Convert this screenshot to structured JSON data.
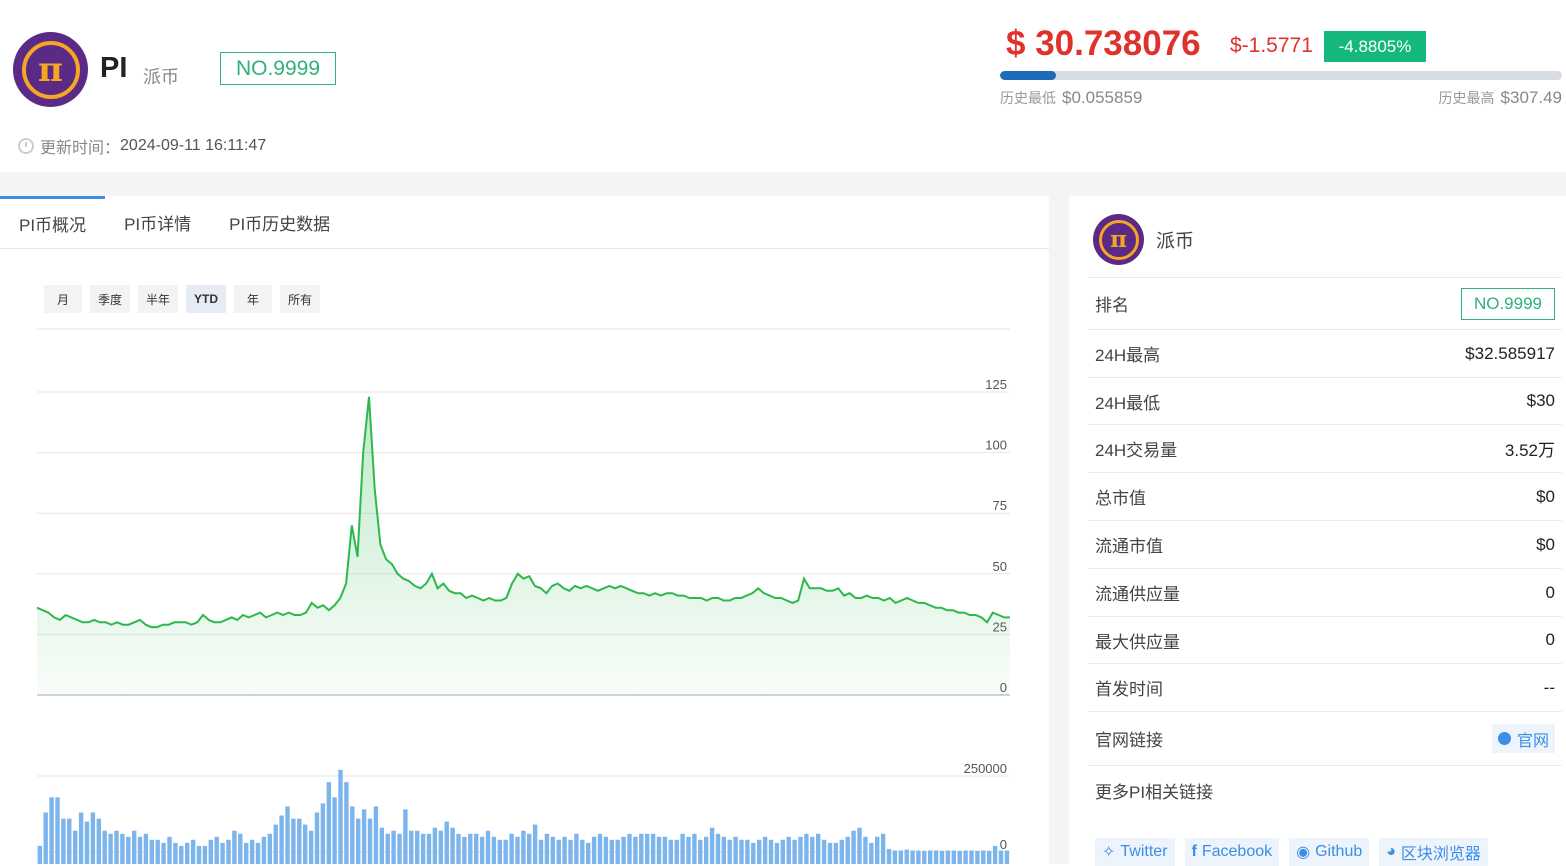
{
  "coin": {
    "symbol": "PI",
    "name": "派币",
    "rank": "NO.9999",
    "logo_icon": "pi-logo-icon"
  },
  "update": {
    "label": "更新时间：",
    "value": "2024-09-11 16:11:47"
  },
  "price": {
    "value": "$ 30.738076",
    "change": "$-1.5771",
    "change_pct": "-4.8805%",
    "range_position": 0.1
  },
  "range": {
    "low_label": "历史最低",
    "low_value": "$0.055859",
    "high_label": "历史最高",
    "high_value": "$307.49"
  },
  "tabs": [
    {
      "label": "PI币概况"
    },
    {
      "label": "PI币详情"
    },
    {
      "label": "PI币历史数据"
    }
  ],
  "range_buttons": [
    {
      "label": "月"
    },
    {
      "label": "季度"
    },
    {
      "label": "半年"
    },
    {
      "label": "YTD"
    },
    {
      "label": "年"
    },
    {
      "label": "所有"
    }
  ],
  "colors": {
    "price_down": "#e0322d",
    "badge_green": "#14b87b",
    "line": "#2db84d",
    "volume": "#7cb5ec"
  },
  "chart_data": {
    "type": "area",
    "price_axis": {
      "ticks": [
        "0",
        "25",
        "50",
        "75",
        "100",
        "125"
      ],
      "ylim": [
        0,
        125
      ]
    },
    "volume_axis": {
      "ticks": [
        "0",
        "250000"
      ],
      "ylim": [
        0,
        250000
      ]
    },
    "price_series": [
      36,
      35,
      34,
      32,
      31,
      33,
      32,
      31,
      30,
      30,
      31,
      30,
      30,
      29,
      30,
      29,
      29,
      30,
      31,
      29,
      28,
      28,
      29,
      29,
      30,
      30,
      30,
      29,
      30,
      33,
      31,
      30,
      30,
      31,
      32,
      31,
      33,
      32,
      33,
      34,
      32,
      33,
      34,
      33,
      34,
      33,
      33,
      34,
      38,
      36,
      37,
      35,
      37,
      40,
      46,
      70,
      57,
      100,
      123,
      85,
      62,
      56,
      54,
      50,
      48,
      47,
      45,
      44,
      46,
      50,
      44,
      46,
      43,
      42,
      42,
      40,
      41,
      40,
      39,
      40,
      39,
      39,
      40,
      46,
      50,
      48,
      49,
      45,
      44,
      42,
      45,
      46,
      44,
      43,
      45,
      44,
      45,
      44,
      43,
      44,
      45,
      44,
      45,
      44,
      43,
      42,
      42,
      41,
      42,
      41,
      42,
      42,
      41,
      41,
      40,
      40,
      40,
      39,
      40,
      40,
      39,
      39,
      40,
      40,
      41,
      42,
      44,
      42,
      41,
      40,
      40,
      39,
      38,
      39,
      48,
      44,
      44,
      44,
      43,
      43,
      44,
      41,
      42,
      40,
      40,
      41,
      40,
      40,
      39,
      40,
      38,
      39,
      40,
      39,
      38,
      38,
      37,
      36,
      36,
      35,
      35,
      34,
      34,
      33,
      33,
      32,
      30,
      34,
      33,
      32,
      32
    ],
    "volume_series": [
      20000,
      130000,
      180000,
      180000,
      110000,
      110000,
      70000,
      130000,
      100000,
      130000,
      110000,
      70000,
      60000,
      70000,
      60000,
      50000,
      70000,
      50000,
      60000,
      40000,
      40000,
      30000,
      50000,
      30000,
      20000,
      30000,
      40000,
      20000,
      20000,
      40000,
      50000,
      30000,
      40000,
      70000,
      60000,
      30000,
      40000,
      30000,
      50000,
      60000,
      90000,
      120000,
      150000,
      110000,
      110000,
      90000,
      70000,
      130000,
      160000,
      230000,
      180000,
      270000,
      230000,
      150000,
      110000,
      140000,
      110000,
      150000,
      80000,
      60000,
      70000,
      60000,
      140000,
      70000,
      70000,
      60000,
      60000,
      80000,
      70000,
      100000,
      80000,
      60000,
      50000,
      60000,
      60000,
      50000,
      70000,
      50000,
      40000,
      40000,
      60000,
      50000,
      70000,
      60000,
      90000,
      40000,
      60000,
      50000,
      40000,
      50000,
      40000,
      60000,
      40000,
      30000,
      50000,
      60000,
      50000,
      40000,
      40000,
      50000,
      60000,
      50000,
      60000,
      60000,
      60000,
      50000,
      50000,
      40000,
      40000,
      60000,
      50000,
      60000,
      40000,
      50000,
      80000,
      60000,
      50000,
      40000,
      50000,
      40000,
      40000,
      30000,
      40000,
      50000,
      40000,
      30000,
      40000,
      50000,
      40000,
      50000,
      60000,
      50000,
      60000,
      40000,
      30000,
      30000,
      40000,
      50000,
      70000,
      80000,
      50000,
      30000,
      50000,
      60000,
      10000,
      5000,
      5000,
      8000,
      5000,
      5000,
      4000,
      5000,
      5000,
      4000,
      5000,
      5000,
      4000,
      5000,
      5000,
      4000,
      5000,
      4000,
      20000,
      5000,
      5000
    ]
  },
  "detail": {
    "name": "派币",
    "rows": [
      {
        "label": "排名",
        "value": "NO.9999"
      },
      {
        "label": "24H最高",
        "value": "$32.585917"
      },
      {
        "label": "24H最低",
        "value": "$30"
      },
      {
        "label": "24H交易量",
        "value": "3.52万"
      },
      {
        "label": "总市值",
        "value": "$0"
      },
      {
        "label": "流通市值",
        "value": "$0"
      },
      {
        "label": "流通供应量",
        "value": "0"
      },
      {
        "label": "最大供应量",
        "value": "0"
      },
      {
        "label": "首发时间",
        "value": "--"
      },
      {
        "label": "官网链接",
        "value": "官网"
      },
      {
        "label": "更多PI相关链接",
        "value": ""
      }
    ],
    "links": [
      {
        "label": "Twitter",
        "icon": "twitter-icon"
      },
      {
        "label": "Facebook",
        "icon": "facebook-icon"
      },
      {
        "label": "Github",
        "icon": "github-icon"
      },
      {
        "label": "区块浏览器",
        "icon": "explorer-icon"
      }
    ]
  }
}
